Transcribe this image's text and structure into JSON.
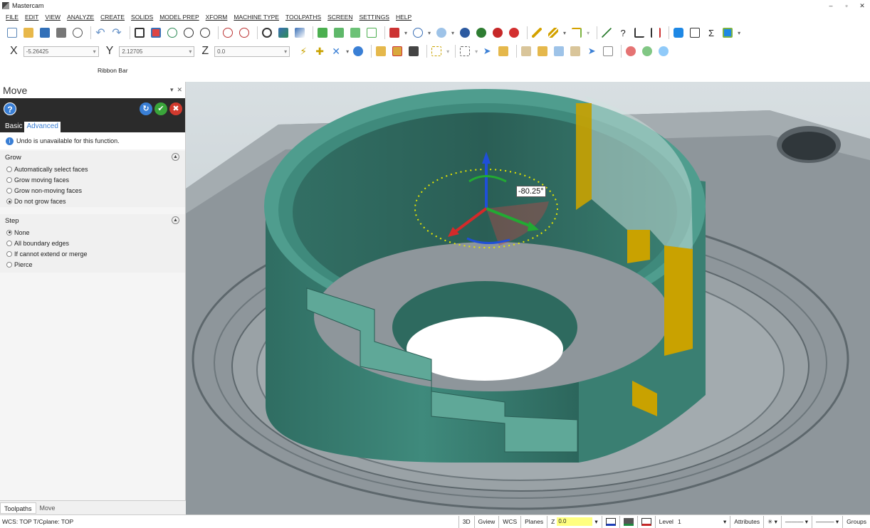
{
  "app": {
    "title": "Mastercam"
  },
  "menu": [
    "FILE",
    "EDIT",
    "VIEW",
    "ANALYZE",
    "CREATE",
    "SOLIDS",
    "MODEL PREP",
    "XFORM",
    "MACHINE TYPE",
    "TOOLPATHS",
    "SCREEN",
    "SETTINGS",
    "HELP"
  ],
  "coords": {
    "x_label": "X",
    "x": "-5.26425",
    "y_label": "Y",
    "y": "2.12705",
    "z_label": "Z",
    "z": "0.0"
  },
  "ribbon_label": "Ribbon Bar",
  "panel": {
    "title": "Move",
    "help": "?",
    "tabs": {
      "basic": "Basic",
      "advanced": "Advanced"
    },
    "info": "Undo is unavailable for this function.",
    "grow": {
      "title": "Grow",
      "options": [
        "Automatically select faces",
        "Grow moving faces",
        "Grow non-moving faces",
        "Do not grow faces"
      ],
      "selected": 3
    },
    "step": {
      "title": "Step",
      "options": [
        "None",
        "All boundary edges",
        "If cannot extend or merge",
        "Pierce"
      ],
      "selected": 0
    },
    "bottom_tabs": [
      "Toolpaths",
      "Move"
    ]
  },
  "viewport": {
    "angle": "-80.25°"
  },
  "status": {
    "left": "WCS: TOP  T/Cplane: TOP",
    "view3d": "3D",
    "gview": "Gview",
    "wcs": "WCS",
    "planes": "Planes",
    "z_label": "Z",
    "z_value": "0.0",
    "level_label": "Level",
    "level_value": "1",
    "attributes": "Attributes",
    "groups": "Groups"
  },
  "colors": {
    "teal": "#3f8a7c",
    "teal_light": "#5fb3a2",
    "yellow": "#c9a200",
    "grey": "#8e969b",
    "help_blue": "#3a7fd5"
  }
}
